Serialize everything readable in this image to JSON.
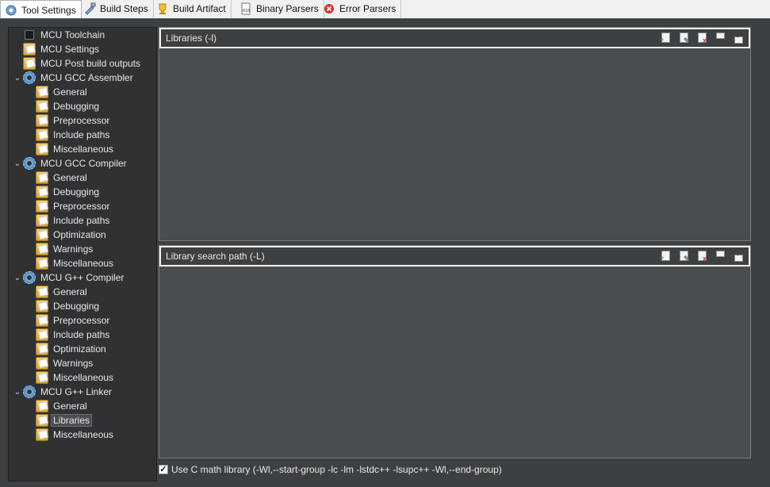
{
  "tabs": [
    {
      "label": "Tool Settings",
      "icon": "tool-settings-icon",
      "active": true
    },
    {
      "label": "Build Steps",
      "icon": "build-steps-icon",
      "active": false
    },
    {
      "label": "Build Artifact",
      "icon": "trophy-icon",
      "active": false
    },
    {
      "label": "Binary Parsers",
      "icon": "binary-file-icon",
      "active": false
    },
    {
      "label": "Error Parsers",
      "icon": "error-icon",
      "active": false
    }
  ],
  "tree": {
    "items": [
      {
        "label": "MCU Toolchain",
        "level": 0,
        "icon": "chip-icon"
      },
      {
        "label": "MCU Settings",
        "level": 0,
        "icon": "folder-icon"
      },
      {
        "label": "MCU Post build outputs",
        "level": 0,
        "icon": "folder-icon"
      },
      {
        "label": "MCU GCC Assembler",
        "level": 0,
        "icon": "gear-icon",
        "expanded": true
      },
      {
        "label": "General",
        "level": 1,
        "icon": "folder-icon"
      },
      {
        "label": "Debugging",
        "level": 1,
        "icon": "folder-icon"
      },
      {
        "label": "Preprocessor",
        "level": 1,
        "icon": "folder-icon"
      },
      {
        "label": "Include paths",
        "level": 1,
        "icon": "folder-icon"
      },
      {
        "label": "Miscellaneous",
        "level": 1,
        "icon": "folder-icon"
      },
      {
        "label": "MCU GCC Compiler",
        "level": 0,
        "icon": "gear-icon",
        "expanded": true
      },
      {
        "label": "General",
        "level": 1,
        "icon": "folder-icon"
      },
      {
        "label": "Debugging",
        "level": 1,
        "icon": "folder-icon"
      },
      {
        "label": "Preprocessor",
        "level": 1,
        "icon": "folder-icon"
      },
      {
        "label": "Include paths",
        "level": 1,
        "icon": "folder-icon"
      },
      {
        "label": "Optimization",
        "level": 1,
        "icon": "folder-icon"
      },
      {
        "label": "Warnings",
        "level": 1,
        "icon": "folder-icon"
      },
      {
        "label": "Miscellaneous",
        "level": 1,
        "icon": "folder-icon"
      },
      {
        "label": "MCU G++ Compiler",
        "level": 0,
        "icon": "gear-icon",
        "expanded": true
      },
      {
        "label": "General",
        "level": 1,
        "icon": "folder-icon"
      },
      {
        "label": "Debugging",
        "level": 1,
        "icon": "folder-icon"
      },
      {
        "label": "Preprocessor",
        "level": 1,
        "icon": "folder-icon"
      },
      {
        "label": "Include paths",
        "level": 1,
        "icon": "folder-icon"
      },
      {
        "label": "Optimization",
        "level": 1,
        "icon": "folder-icon"
      },
      {
        "label": "Warnings",
        "level": 1,
        "icon": "folder-icon"
      },
      {
        "label": "Miscellaneous",
        "level": 1,
        "icon": "folder-icon"
      },
      {
        "label": "MCU G++ Linker",
        "level": 0,
        "icon": "gear-icon",
        "expanded": true
      },
      {
        "label": "General",
        "level": 1,
        "icon": "folder-icon"
      },
      {
        "label": "Libraries",
        "level": 1,
        "icon": "folder-icon",
        "selected": true
      },
      {
        "label": "Miscellaneous",
        "level": 1,
        "icon": "folder-icon"
      }
    ]
  },
  "libraries_panel": {
    "title": "Libraries (-l)",
    "buttons": [
      "add-icon",
      "edit-icon",
      "delete-icon",
      "move-up-icon",
      "move-down-icon"
    ],
    "entries": []
  },
  "search_path_panel": {
    "title": "Library search path (-L)",
    "buttons": [
      "add-icon",
      "edit-icon",
      "delete-icon",
      "move-up-icon",
      "move-down-icon"
    ],
    "entries": []
  },
  "math_option": {
    "label": "Use C math library (-Wl,--start-group -lc -lm -lstdc++ -lsupc++ -Wl,--end-group)",
    "checked": true
  }
}
